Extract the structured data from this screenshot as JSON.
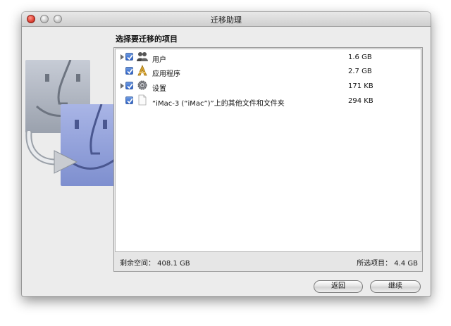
{
  "window": {
    "title": "迁移助理"
  },
  "heading": "选择要迁移的项目",
  "items": [
    {
      "label": "用户",
      "size": "1.6 GB",
      "checked": true,
      "expandable": true,
      "icon": "users-icon"
    },
    {
      "label": "应用程序",
      "size": "2.7 GB",
      "checked": true,
      "expandable": false,
      "icon": "applications-icon"
    },
    {
      "label": "设置",
      "size": "171 KB",
      "checked": true,
      "expandable": true,
      "icon": "settings-gear-icon"
    },
    {
      "label": "“iMac-3 (“iMac”)”上的其他文件和文件夹",
      "size": "294 KB",
      "checked": true,
      "expandable": false,
      "icon": "document-icon"
    }
  ],
  "footer": {
    "free_space": "剩余空间： 408.1 GB",
    "selected": "所选项目： 4.4 GB"
  },
  "buttons": {
    "back": "返回",
    "continue": "继续"
  },
  "colors": {
    "checkbox": "#2d61c8",
    "close": "#e0463a"
  }
}
